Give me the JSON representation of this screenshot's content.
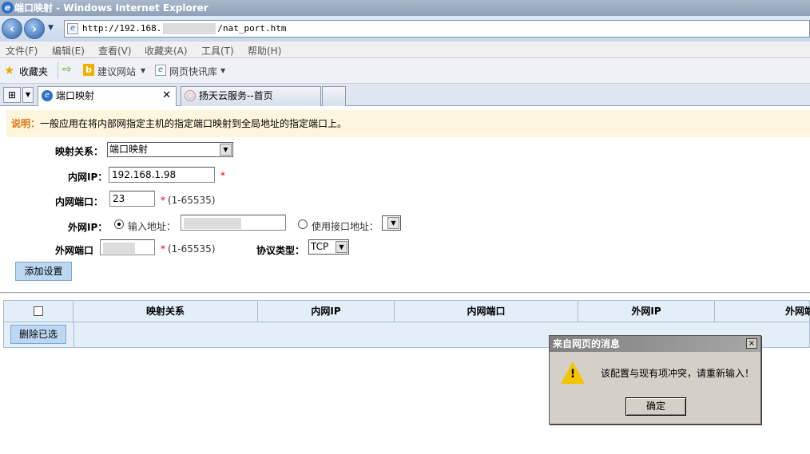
{
  "window": {
    "title": "端口映射 - Windows Internet Explorer"
  },
  "address": {
    "url_prefix": "http://192.168.",
    "url_suffix": "/nat_port.htm"
  },
  "menu": [
    "文件(F)",
    "编辑(E)",
    "查看(V)",
    "收藏夹(A)",
    "工具(T)",
    "帮助(H)"
  ],
  "favorites": {
    "label": "收藏夹",
    "suggested": "建议网站",
    "web_slices": "网页快讯库"
  },
  "tabs": [
    {
      "label": "端口映射",
      "active": true
    },
    {
      "label": "扬天云服务--首页",
      "active": false
    }
  ],
  "notice": {
    "label": "说明：",
    "text": "一般应用在将内部网指定主机的指定端口映射到全局地址的指定端口上。"
  },
  "form": {
    "mapping_label": "映射关系：",
    "mapping_value": "端口映射",
    "lan_ip_label": "内网IP：",
    "lan_ip_value": "192.168.1.98",
    "lan_port_label": "内网端口：",
    "lan_port_value": "23",
    "range_hint": "(1-65535)",
    "required_mark": "*",
    "wan_ip_label": "外网IP：",
    "radio_input_addr": "输入地址：",
    "radio_use_iface": "使用接口地址：",
    "wan_port_label": "外网端口",
    "protocol_label": "协议类型：",
    "protocol_value": "TCP",
    "add_button": "添加设置"
  },
  "table": {
    "headers": [
      "映射关系",
      "内网IP",
      "内网端口",
      "外网IP",
      "外网端"
    ],
    "delete_button": "删除已选"
  },
  "dialog": {
    "title": "来自网页的消息",
    "message": "该配置与现有项冲突，请重新输入！",
    "ok": "确定",
    "close": "×"
  },
  "colors": {
    "notice_bg": "#fdf6dd",
    "notice_label": "#e37714",
    "required": "#ee0000",
    "table_header_bg": "#e3eef9"
  }
}
